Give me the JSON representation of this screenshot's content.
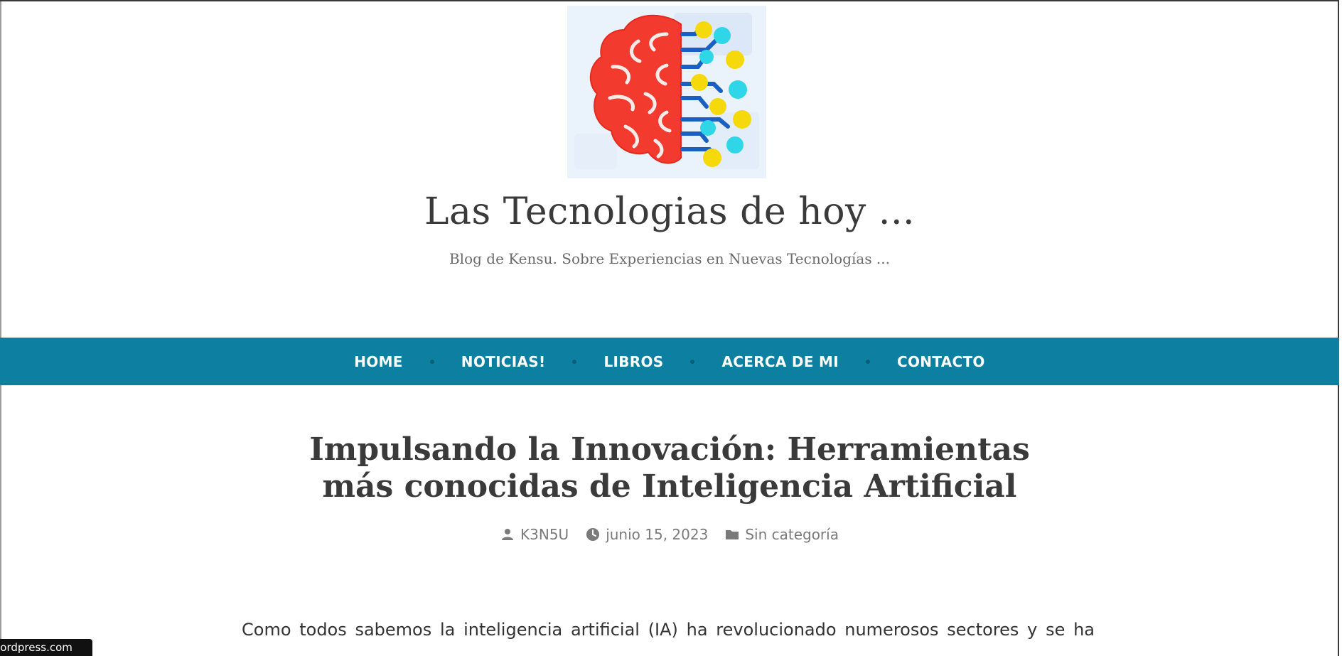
{
  "header": {
    "site_title": "Las Tecnologias de hoy ...",
    "tagline": "Blog de Kensu. Sobre Experiencias en Nuevas Tecnologías ...",
    "logo_icon": "brain-circuit-logo"
  },
  "nav": {
    "items": [
      {
        "label": "HOME"
      },
      {
        "label": "NOTICIAS!"
      },
      {
        "label": "LIBROS"
      },
      {
        "label": "ACERCA DE MI"
      },
      {
        "label": "CONTACTO"
      }
    ],
    "background": "#0d7fa0"
  },
  "post": {
    "title": "Impulsando la Innovación: Herramientas más conocidas de Inteligencia Artificial",
    "author": "K3N5U",
    "date": "junio 15, 2023",
    "category": "Sin categoría",
    "body_first_line": "Como todos sabemos la inteligencia artificial (IA) ha revolucionado numerosos sectores y se ha"
  },
  "footer_badge": {
    "label": "wordpress.com"
  },
  "colors": {
    "nav_bg": "#0d7fa0",
    "brain_red": "#f23a2e",
    "node_yellow": "#f5d90a",
    "node_cyan": "#2fd6e8",
    "circuit_blue": "#1a5fc4"
  }
}
